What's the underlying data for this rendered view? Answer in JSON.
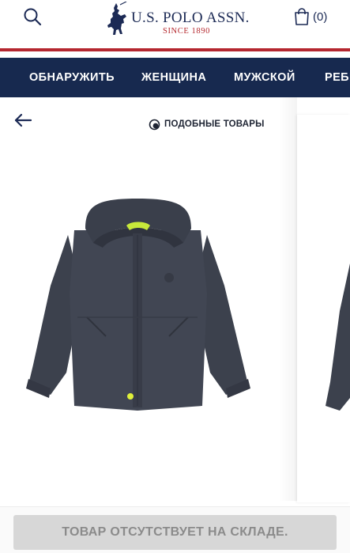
{
  "brand": {
    "name": "U.S. POLO ASSN.",
    "since": "SINCE 1890"
  },
  "header": {
    "cart_count": "(0)"
  },
  "nav": {
    "items": [
      "ОБНАРУЖИТЬ",
      "ЖЕНЩИНА",
      "МУЖСКОЙ",
      "РЕБЕНОК"
    ]
  },
  "product": {
    "similar_label": "ПОДОБНЫЕ ТОВАРЫ",
    "out_of_stock_label": "ТОВАР ОТСУТСТВУЕТ НА СКЛАДЕ.",
    "jacket_color": "#3f4450",
    "lining_color": "#c7e83a"
  },
  "colors": {
    "navy": "#17294f",
    "brand_red": "#b5272f"
  },
  "icons": {
    "search": "search-icon",
    "cart": "shopping-bag-icon",
    "back": "arrow-left-icon",
    "similar": "similar-products-icon"
  }
}
